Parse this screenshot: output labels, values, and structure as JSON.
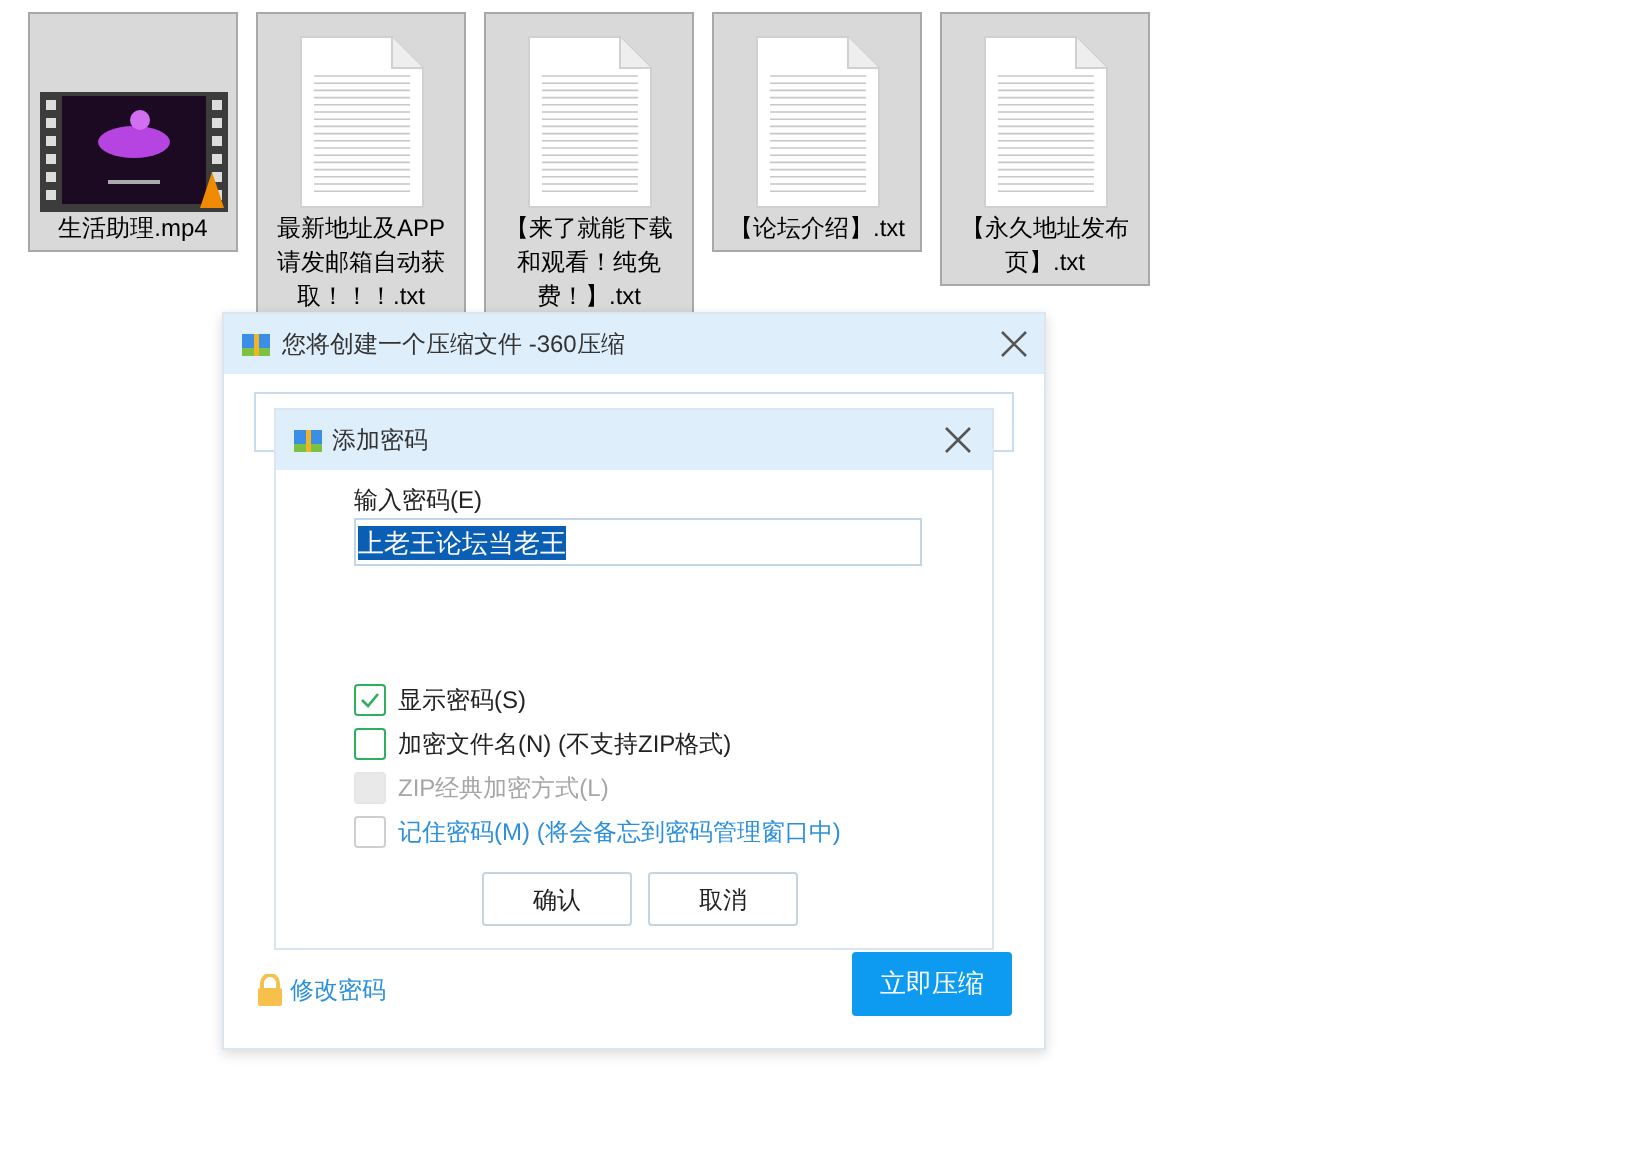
{
  "files": [
    {
      "kind": "video",
      "name": "生活助理.mp4"
    },
    {
      "kind": "text",
      "name": "最新地址及APP请发邮箱自动获取！！！.txt"
    },
    {
      "kind": "text",
      "name": "【来了就能下载和观看！纯免费！】.txt"
    },
    {
      "kind": "text",
      "name": "【论坛介绍】.txt"
    },
    {
      "kind": "text",
      "name": "【永久地址发布页】.txt"
    }
  ],
  "compress_dialog": {
    "title": "您将创建一个压缩文件 -360压缩",
    "change_password_link": "修改密码",
    "compress_button": "立即压缩"
  },
  "password_dialog": {
    "title": "添加密码",
    "password_label": "输入密码(E)",
    "password_value": "上老王论坛当老王",
    "options": [
      {
        "label": "显示密码(S)",
        "checked": true,
        "disabled": false,
        "link": false
      },
      {
        "label": "加密文件名(N) (不支持ZIP格式)",
        "checked": false,
        "disabled": false,
        "link": false
      },
      {
        "label": "ZIP经典加密方式(L)",
        "checked": false,
        "disabled": true,
        "link": false
      },
      {
        "label": "记住密码(M) (将会备忘到密码管理窗口中)",
        "checked": false,
        "disabled": false,
        "link": true
      }
    ],
    "buttons": [
      "确认",
      "取消"
    ]
  }
}
